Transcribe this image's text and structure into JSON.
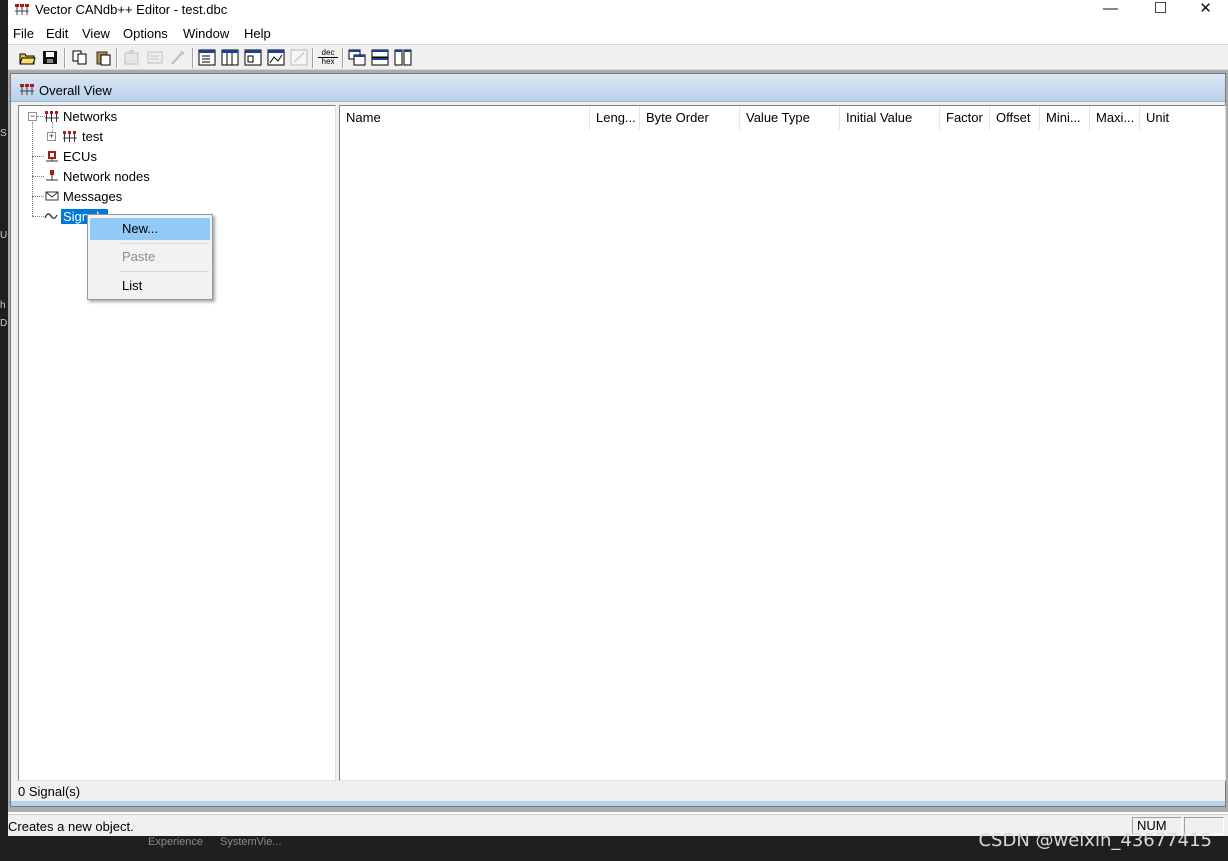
{
  "window": {
    "title": "Vector CANdb++ Editor - test.dbc",
    "controls": [
      "—",
      "☐",
      "✕"
    ]
  },
  "menu": [
    "File",
    "Edit",
    "View",
    "Options",
    "Window",
    "Help"
  ],
  "toolbar": {
    "buttons": [
      "open-folder-icon",
      "save-icon",
      "copy-icon",
      "paste-icon",
      "properties-icon",
      "form-icon",
      "wand-icon",
      "tree-view-icon",
      "table-view-icon",
      "window-icon",
      "graph-icon",
      "disabled-view-icon",
      "dec-hex-icon",
      "cascade-icon",
      "tile-horizontal-icon",
      "tile-vertical-icon"
    ],
    "dec_hex_label_top": "dec",
    "dec_hex_label_bottom": "hex"
  },
  "child_window": {
    "title": "Overall View",
    "tree": {
      "networks": "Networks",
      "test": "test",
      "ecus": "ECUs",
      "network_nodes": "Network nodes",
      "messages": "Messages",
      "signals": "Signals"
    },
    "columns": [
      "Name",
      "Leng...",
      "Byte Order",
      "Value Type",
      "Initial Value",
      "Factor",
      "Offset",
      "Mini...",
      "Maxi...",
      "Unit"
    ],
    "status": "0 Signal(s)"
  },
  "context_menu": {
    "new": "New...",
    "paste": "Paste",
    "list": "List"
  },
  "statusbar": {
    "text": "Creates a new object.",
    "num": "NUM"
  },
  "watermark": "CSDN @weixin_43677415",
  "taskbar_ghost": [
    "Experience",
    "SystemVie..."
  ],
  "colors": {
    "selection": "#0078d7",
    "menu_hot": "#91c9f7",
    "child_title": "#b9d1ea"
  }
}
